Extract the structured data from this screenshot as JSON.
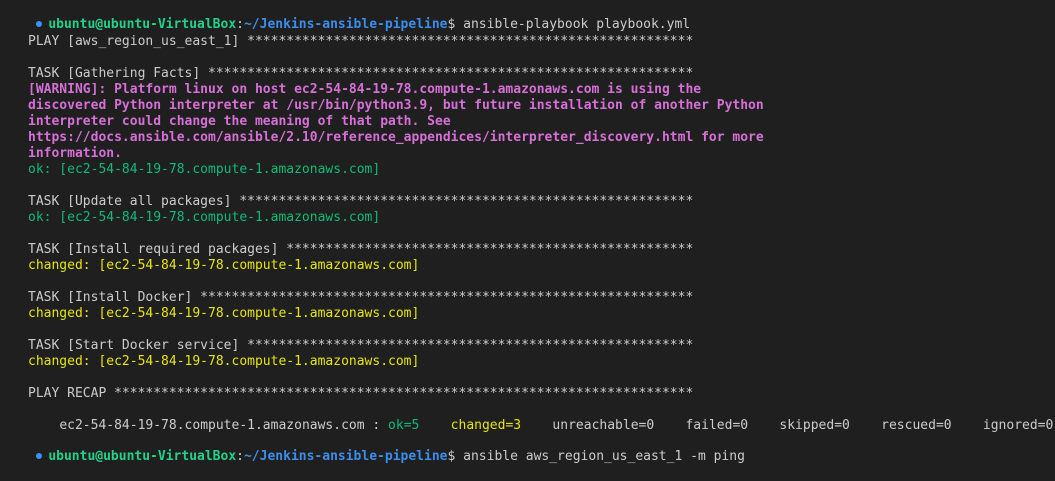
{
  "prompt": {
    "user_host": "ubuntu@ubuntu-VirtualBox",
    "sep": ":",
    "path": "~/Jenkins-ansible-pipeline",
    "symbol": "$",
    "command": " ansible-playbook playbook.yml"
  },
  "play_header": "PLAY [aws_region_us_east_1] *********************************************************",
  "tasks": {
    "gathering": {
      "header": "TASK [Gathering Facts] **************************************************************",
      "warning": [
        "[WARNING]: Platform linux on host ec2-54-84-19-78.compute-1.amazonaws.com is using the",
        "discovered Python interpreter at /usr/bin/python3.9, but future installation of another Python",
        "interpreter could change the meaning of that path. See",
        "https://docs.ansible.com/ansible/2.10/reference_appendices/interpreter_discovery.html for more",
        "information."
      ],
      "result": "ok: [ec2-54-84-19-78.compute-1.amazonaws.com]"
    },
    "update": {
      "header": "TASK [Update all packages] **********************************************************",
      "result": "ok: [ec2-54-84-19-78.compute-1.amazonaws.com]"
    },
    "install_packages": {
      "header": "TASK [Install required packages] ****************************************************",
      "result": "changed: [ec2-54-84-19-78.compute-1.amazonaws.com]"
    },
    "install_docker": {
      "header": "TASK [Install Docker] ***************************************************************",
      "result": "changed: [ec2-54-84-19-78.compute-1.amazonaws.com]"
    },
    "start_docker": {
      "header": "TASK [Start Docker service] *********************************************************",
      "result": "changed: [ec2-54-84-19-78.compute-1.amazonaws.com]"
    }
  },
  "recap": {
    "header": "PLAY RECAP **************************************************************************",
    "host": "ec2-54-84-19-78.compute-1.amazonaws.com : ",
    "ok": "ok=5",
    "gap1": "    ",
    "changed": "changed=3",
    "rest": "    unreachable=0    failed=0    skipped=0    rescued=0    ignored=0"
  },
  "next_prompt": {
    "user_host": "ubuntu@ubuntu-VirtualBox",
    "sep": ":",
    "path": "~/Jenkins-ansible-pipeline",
    "symbol": "$",
    "command": " ansible aws_region_us_east_1 -m ping"
  },
  "colors": {
    "background": "#1f1f1f",
    "text": "#cccccc",
    "user": "#23d18b",
    "path": "#3b8eea",
    "warning": "#d670d6",
    "ok": "#0dbc79",
    "changed": "#e5e510",
    "prompt_dot": "#3794ff"
  }
}
